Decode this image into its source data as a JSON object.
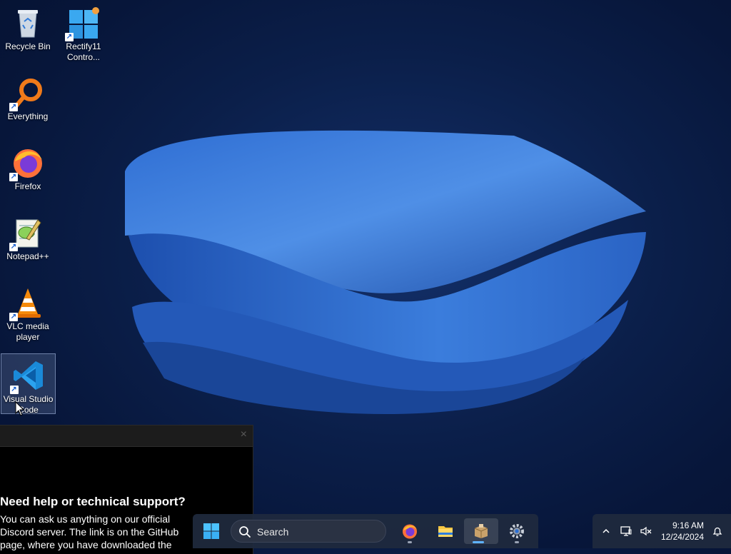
{
  "desktop": {
    "icons": [
      {
        "label": "Recycle Bin",
        "icon": "recycle-bin-icon"
      },
      {
        "label": "Rectify11 Contro...",
        "icon": "rectify11-control-panel-icon"
      },
      {
        "label": "Everything",
        "icon": "everything-search-icon"
      },
      {
        "label": "Firefox",
        "icon": "firefox-icon"
      },
      {
        "label": "Notepad++",
        "icon": "notepad-plus-plus-icon"
      },
      {
        "label": "VLC media player",
        "icon": "vlc-icon"
      },
      {
        "label": "Visual Studio Code",
        "icon": "vscode-icon"
      }
    ]
  },
  "popup": {
    "close": "×",
    "heading": "Need help or technical support?",
    "body": "You can ask us anything on our official Discord server. The link is on the GitHub page, where you have downloaded the"
  },
  "taskbar": {
    "search_placeholder": "Search",
    "apps": [
      {
        "name": "Firefox",
        "icon": "firefox-icon"
      },
      {
        "name": "File Explorer",
        "icon": "folder-icon"
      },
      {
        "name": "Active app",
        "icon": "package-icon"
      },
      {
        "name": "Settings",
        "icon": "gear-icon"
      }
    ]
  },
  "tray": {
    "time": "9:16 AM",
    "date": "12/24/2024"
  },
  "colors": {
    "accent": "#5fb3ff",
    "wallpaper_bloom": "#3a7ad8",
    "wallpaper_bg": "#0b1f4a"
  }
}
